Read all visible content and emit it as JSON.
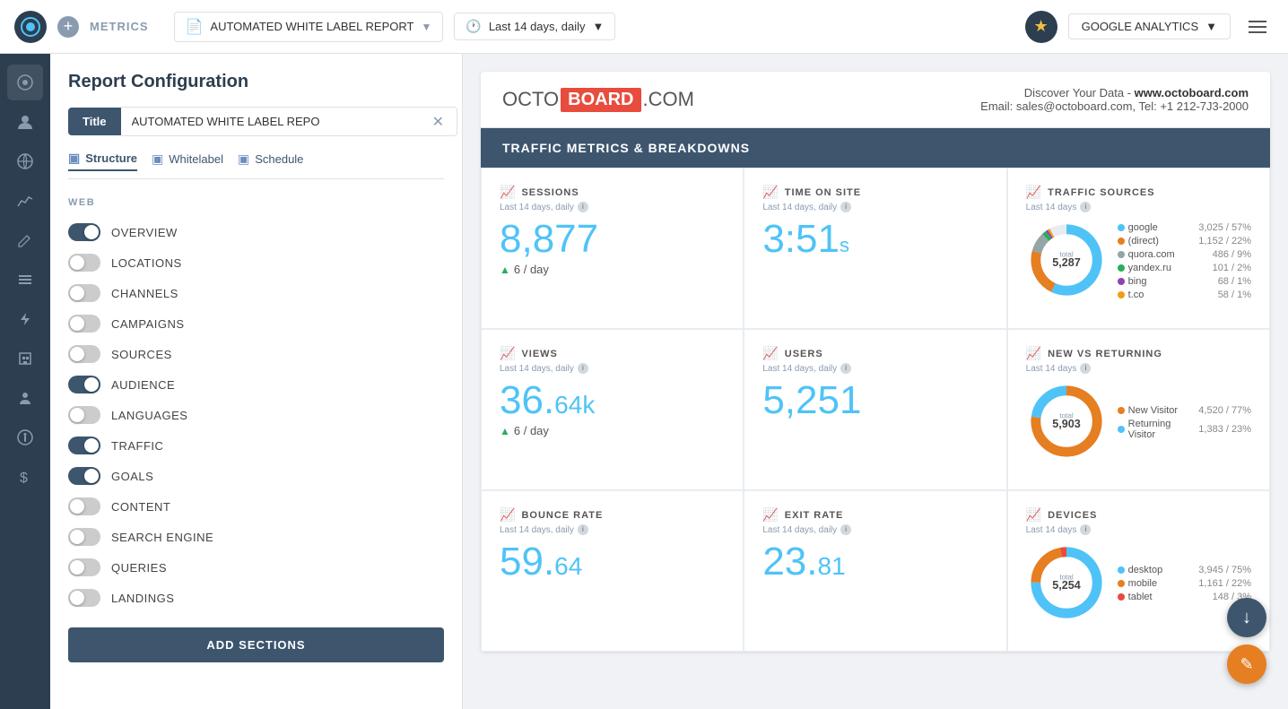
{
  "topnav": {
    "logo_text": "O",
    "plus_label": "+",
    "metrics_label": "METRICS",
    "report_name": "AUTOMATED WHITE LABEL REPORT",
    "date_range": "Last 14 days, daily",
    "ga_label": "GOOGLE ANALYTICS"
  },
  "config": {
    "title": "Report Configuration",
    "title_label": "Title",
    "title_value": "AUTOMATED WHITE LABEL REPO",
    "tabs": [
      {
        "label": "Structure",
        "active": true
      },
      {
        "label": "Whitelabel",
        "active": false
      },
      {
        "label": "Schedule",
        "active": false
      }
    ],
    "web_section": "WEB",
    "toggles": [
      {
        "label": "OVERVIEW",
        "on": true
      },
      {
        "label": "LOCATIONS",
        "on": false
      },
      {
        "label": "CHANNELS",
        "on": false
      },
      {
        "label": "CAMPAIGNS",
        "on": false
      },
      {
        "label": "SOURCES",
        "on": false
      },
      {
        "label": "AUDIENCE",
        "on": true
      },
      {
        "label": "LANGUAGES",
        "on": false
      },
      {
        "label": "TRAFFIC",
        "on": true
      },
      {
        "label": "GOALS",
        "on": true
      },
      {
        "label": "CONTENT",
        "on": false
      },
      {
        "label": "SEARCH ENGINE",
        "on": false
      },
      {
        "label": "QUERIES",
        "on": false
      },
      {
        "label": "LANDINGS",
        "on": false
      }
    ],
    "add_sections_btn": "ADD SECTIONS"
  },
  "report": {
    "logo_left": "OCTO",
    "logo_box": "BOARD",
    "logo_right": ".COM",
    "tagline": "Discover Your Data - www.octoboard.com",
    "email_label": "Email:",
    "email": "sales@octoboard.com",
    "tel_label": "Tel:",
    "tel": "+1 212-7J3-2000",
    "section_title": "TRAFFIC METRICS & BREAKDOWNS",
    "metrics": [
      {
        "title": "SESSIONS",
        "subtitle": "Last 14 days, daily",
        "value": "8,877",
        "change": "6 / day",
        "change_dir": "up",
        "type": "number"
      },
      {
        "title": "TIME ON SITE",
        "subtitle": "Last 14 days, daily",
        "value": "3:51",
        "suffix": "s",
        "type": "time"
      },
      {
        "title": "TRAFFIC SOURCES",
        "subtitle": "Last 14 days",
        "total_label": "total",
        "total": "5,287",
        "type": "donut",
        "legend": [
          {
            "name": "google",
            "value": "3,025",
            "pct": "57%",
            "color": "#4fc3f7"
          },
          {
            "name": "(direct)",
            "value": "1,152",
            "pct": "22%",
            "color": "#e67e22"
          },
          {
            "name": "quora.com",
            "value": "486",
            "pct": "9%",
            "color": "#95a5a6"
          },
          {
            "name": "yandex.ru",
            "value": "101",
            "pct": "2%",
            "color": "#27ae60"
          },
          {
            "name": "bing",
            "value": "68",
            "pct": "1%",
            "color": "#8e44ad"
          },
          {
            "name": "t.co",
            "value": "58",
            "pct": "1%",
            "color": "#f39c12"
          }
        ]
      },
      {
        "title": "VIEWS",
        "subtitle": "Last 14 days, daily",
        "value": "36.",
        "value2": "64k",
        "change": "6 / day",
        "change_dir": "up",
        "type": "number2"
      },
      {
        "title": "USERS",
        "subtitle": "Last 14 days, daily",
        "value": "5,251",
        "type": "number"
      },
      {
        "title": "NEW VS RETURNING",
        "subtitle": "Last 14 days",
        "total_label": "total",
        "total": "5,903",
        "type": "donut2",
        "legend": [
          {
            "name": "New Visitor",
            "value": "4,520",
            "pct": "77%",
            "color": "#e67e22"
          },
          {
            "name": "Returning Visitor",
            "value": "1,383",
            "pct": "23%",
            "color": "#4fc3f7"
          }
        ]
      },
      {
        "title": "BOUNCE RATE",
        "subtitle": "Last 14 days, daily",
        "value": "59.",
        "value2": "64",
        "type": "number2"
      },
      {
        "title": "EXIT RATE",
        "subtitle": "Last 14 days, daily",
        "value": "23.",
        "value2": "81",
        "type": "number2"
      },
      {
        "title": "DEVICES",
        "subtitle": "Last 14 days",
        "total_label": "total",
        "total": "5,254",
        "type": "donut3",
        "legend": [
          {
            "name": "desktop",
            "value": "3,945",
            "pct": "75%",
            "color": "#4fc3f7"
          },
          {
            "name": "mobile",
            "value": "1,161",
            "pct": "22%",
            "color": "#e67e22"
          },
          {
            "name": "tablet",
            "value": "148",
            "pct": "3%",
            "color": "#e74c3c"
          }
        ]
      }
    ]
  },
  "icons": {
    "circle_icon": "●",
    "trend_up": "📈",
    "info": "i",
    "download": "↓",
    "edit": "✏"
  }
}
